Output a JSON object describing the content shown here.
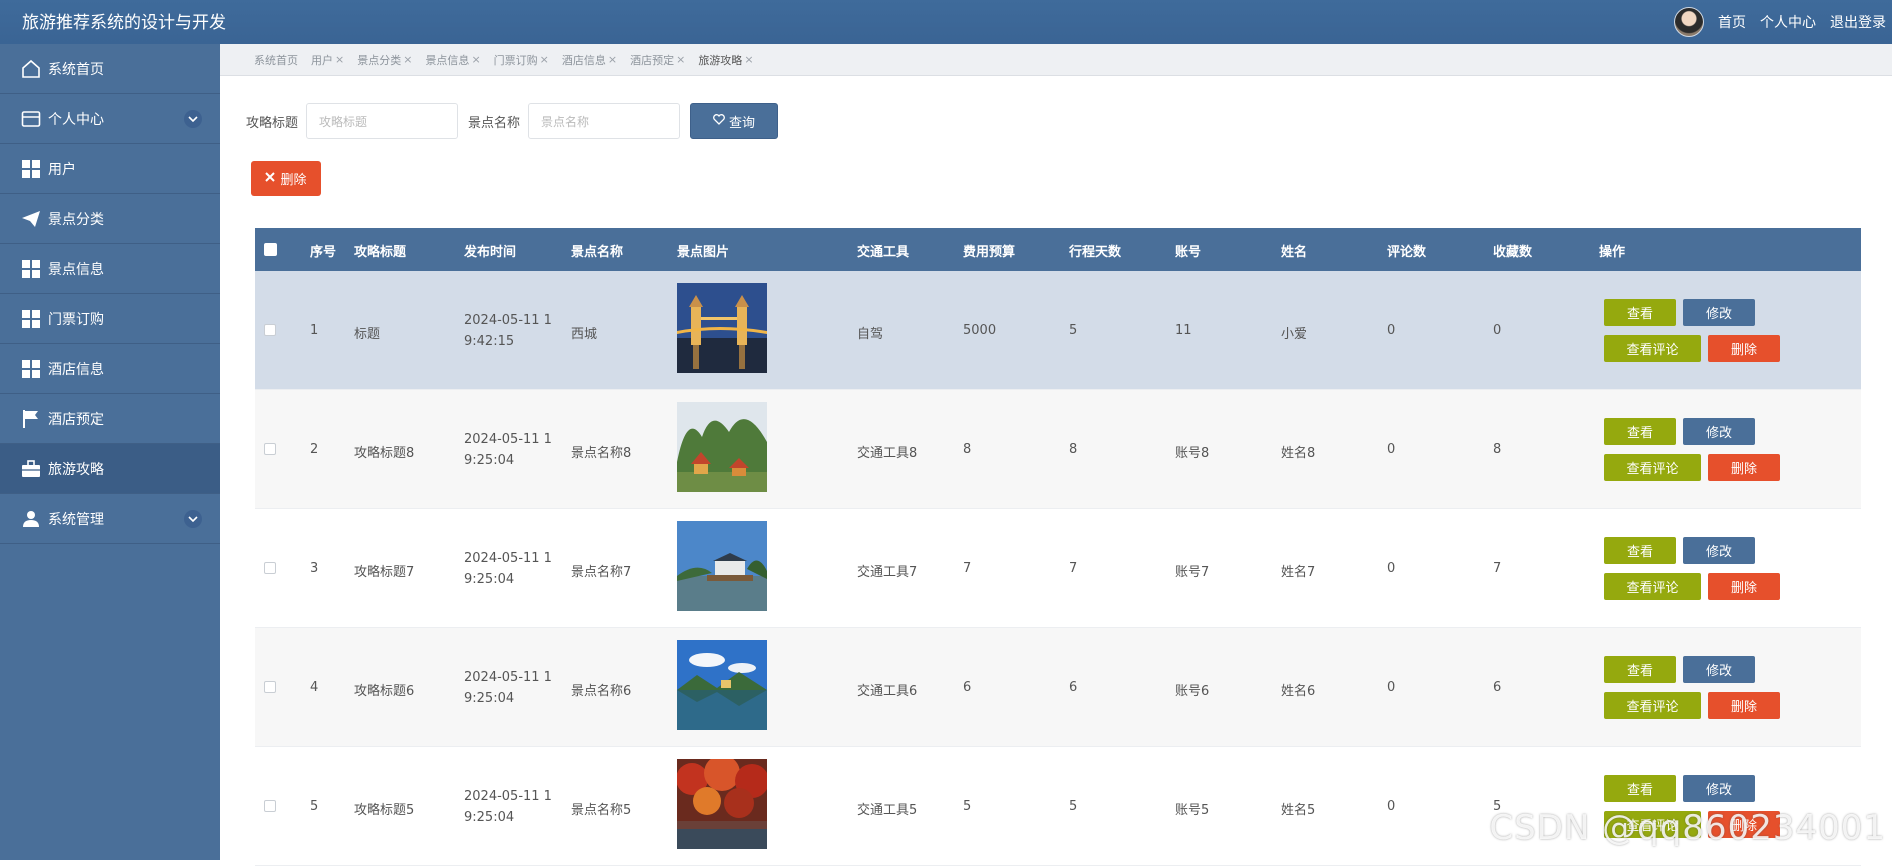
{
  "app": {
    "title": "旅游推荐系统的设计与开发"
  },
  "topnav": {
    "home": "首页",
    "profile": "个人中心",
    "logout": "退出登录"
  },
  "sidebar": {
    "items": [
      {
        "label": "系统首页",
        "icon": "home-icon"
      },
      {
        "label": "个人中心",
        "icon": "wallet-icon"
      },
      {
        "label": "用户",
        "icon": "grid-icon"
      },
      {
        "label": "景点分类",
        "icon": "paper-plane-icon"
      },
      {
        "label": "景点信息",
        "icon": "grid-icon"
      },
      {
        "label": "门票订购",
        "icon": "grid-icon"
      },
      {
        "label": "酒店信息",
        "icon": "grid-icon"
      },
      {
        "label": "酒店预定",
        "icon": "flag-icon"
      },
      {
        "label": "旅游攻略",
        "icon": "briefcase-icon"
      },
      {
        "label": "系统管理",
        "icon": "user-icon"
      }
    ]
  },
  "tabs": [
    "系统首页",
    "用户",
    "景点分类",
    "景点信息",
    "门票订购",
    "酒店信息",
    "酒店预定",
    "旅游攻略"
  ],
  "tab_close": "×",
  "search": {
    "title_label": "攻略标题",
    "title_placeholder": "攻略标题",
    "name_label": "景点名称",
    "name_placeholder": "景点名称",
    "query_button": "查询"
  },
  "delete_button": "删除",
  "table": {
    "headers": [
      "序号",
      "攻略标题",
      "发布时间",
      "景点名称",
      "景点图片",
      "交通工具",
      "费用预算",
      "行程天数",
      "账号",
      "姓名",
      "评论数",
      "收藏数",
      "操作"
    ],
    "rows": [
      {
        "no": "1",
        "title": "标题",
        "time": "2024-05-11 19:42:15",
        "spot": "西城",
        "transport": "自驾",
        "budget": "5000",
        "days": "5",
        "account": "11",
        "name": "小爱",
        "comments": "0",
        "favs": "0",
        "image": "tower-bridge-night"
      },
      {
        "no": "2",
        "title": "攻略标题8",
        "time": "2024-05-11 19:25:04",
        "spot": "景点名称8",
        "transport": "交通工具8",
        "budget": "8",
        "days": "8",
        "account": "账号8",
        "name": "姓名8",
        "comments": "0",
        "favs": "8",
        "image": "karst-pagoda"
      },
      {
        "no": "3",
        "title": "攻略标题7",
        "time": "2024-05-11 19:25:04",
        "spot": "景点名称7",
        "transport": "交通工具7",
        "budget": "7",
        "days": "7",
        "account": "账号7",
        "name": "姓名7",
        "comments": "0",
        "favs": "7",
        "image": "lake-boat"
      },
      {
        "no": "4",
        "title": "攻略标题6",
        "time": "2024-05-11 19:25:04",
        "spot": "景点名称6",
        "transport": "交通工具6",
        "budget": "6",
        "days": "6",
        "account": "账号6",
        "name": "姓名6",
        "comments": "0",
        "favs": "6",
        "image": "mountain-lake"
      },
      {
        "no": "5",
        "title": "攻略标题5",
        "time": "2024-05-11 19:25:04",
        "spot": "景点名称5",
        "transport": "交通工具5",
        "budget": "5",
        "days": "5",
        "account": "账号5",
        "name": "姓名5",
        "comments": "0",
        "favs": "5",
        "image": "autumn-trees"
      }
    ],
    "actions": {
      "view": "查看",
      "edit": "修改",
      "comments": "查看评论",
      "delete": "删除"
    }
  },
  "watermark": "CSDN @qq860234001"
}
